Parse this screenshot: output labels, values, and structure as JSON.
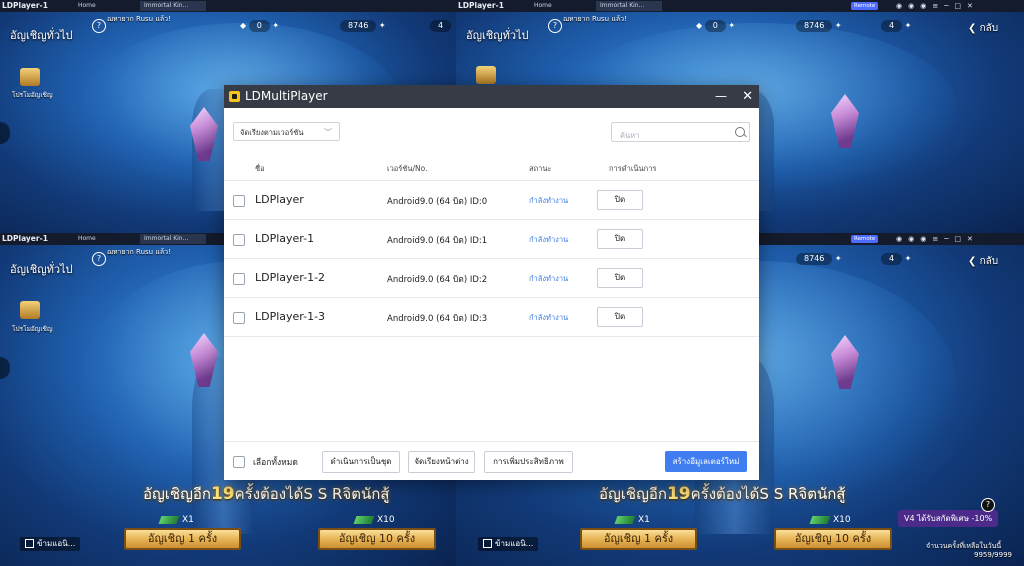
{
  "instances": {
    "tl": {
      "window_title": "LDPlayer-1",
      "tab_home": "Home",
      "tab_game": "Immortal Kin...",
      "invite_title": "อัญเชิญทั่วไป",
      "scroll_msg": "ฌหายาก Rusu แล้ว!",
      "gems": "0",
      "gold": "8746",
      "tickets": "4",
      "gift_label": "โปรโมอัญเชิญ"
    },
    "tr": {
      "window_title": "LDPlayer-1",
      "tab_home": "Home",
      "tab_game": "Immortal Kin...",
      "remote": "Remote",
      "invite_title": "อัญเชิญทั่วไป",
      "scroll_msg": "ฌหายาก Rusu แล้ว!",
      "gems": "0",
      "gold": "8746",
      "tickets": "4",
      "back": "กลับ"
    },
    "bl": {
      "window_title": "LDPlayer-1",
      "tab_home": "Home",
      "tab_game": "Immortal Kin...",
      "invite_title": "อัญเชิญทั่วไป",
      "scroll_msg": "ฌหายาก Rusu แล้ว!",
      "gift_label": "โปรโมอัญเชิญ",
      "banner_pre": "อัญเชิญอีก",
      "banner_num": "19",
      "banner_post": "ครั้งต้องได้S S Rจิตนักสู้",
      "cost1": "X1",
      "cost10": "X10",
      "skip": "ข้ามแอนิ...",
      "pull1": "อัญเชิญ 1 ครั้ง",
      "pull10": "อัญเชิญ 10 ครั้ง"
    },
    "br": {
      "remote": "Remote",
      "gold": "8746",
      "tickets": "4",
      "back": "กลับ",
      "banner_pre": "อัญเชิญอีก",
      "banner_num": "19",
      "banner_post": "ครั้งต้องได้S S Rจิตนักสู้",
      "cost1": "X1",
      "cost10": "X10",
      "skip": "ข้ามแอนิ...",
      "pull1": "อัญเชิญ 1 ครั้ง",
      "pull10": "อัญเชิญ 10 ครั้ง",
      "promo": "V4 ได้รับสกัดพิเศษ -10%",
      "counter_label": "จำนวนครั้งที่เหลือในวันนี้",
      "counter": "9959/9999"
    }
  },
  "dialog": {
    "title": "LDMultiPlayer",
    "minimize": "—",
    "close": "✕",
    "sort_label": "จัดเรียงตามเวอร์ชัน",
    "search_placeholder": "ค้นหา",
    "columns": {
      "name": "ชื่อ",
      "version": "เวอร์ชัน/No.",
      "status": "สถานะ",
      "action": "การดำเนินการ"
    },
    "rows": [
      {
        "name": "LDPlayer",
        "version": "Android9.0 (64 บิต) ID:0",
        "status": "กำลังทำงาน",
        "action": "ปิด"
      },
      {
        "name": "LDPlayer-1",
        "version": "Android9.0 (64 บิต) ID:1",
        "status": "กำลังทำงาน",
        "action": "ปิด"
      },
      {
        "name": "LDPlayer-1-2",
        "version": "Android9.0 (64 บิต) ID:2",
        "status": "กำลังทำงาน",
        "action": "ปิด"
      },
      {
        "name": "LDPlayer-1-3",
        "version": "Android9.0 (64 บิต) ID:3",
        "status": "กำลังทำงาน",
        "action": "ปิด"
      }
    ],
    "footer": {
      "select_all": "เลือกทั้งหมด",
      "batch": "ดำเนินการเป็นชุด",
      "arrange": "จัดเรียงหน้าต่าง",
      "optimize": "การเพิ่มประสิทธิภาพ",
      "create": "สร้างอีมูเลเตอร์ใหม่"
    }
  }
}
